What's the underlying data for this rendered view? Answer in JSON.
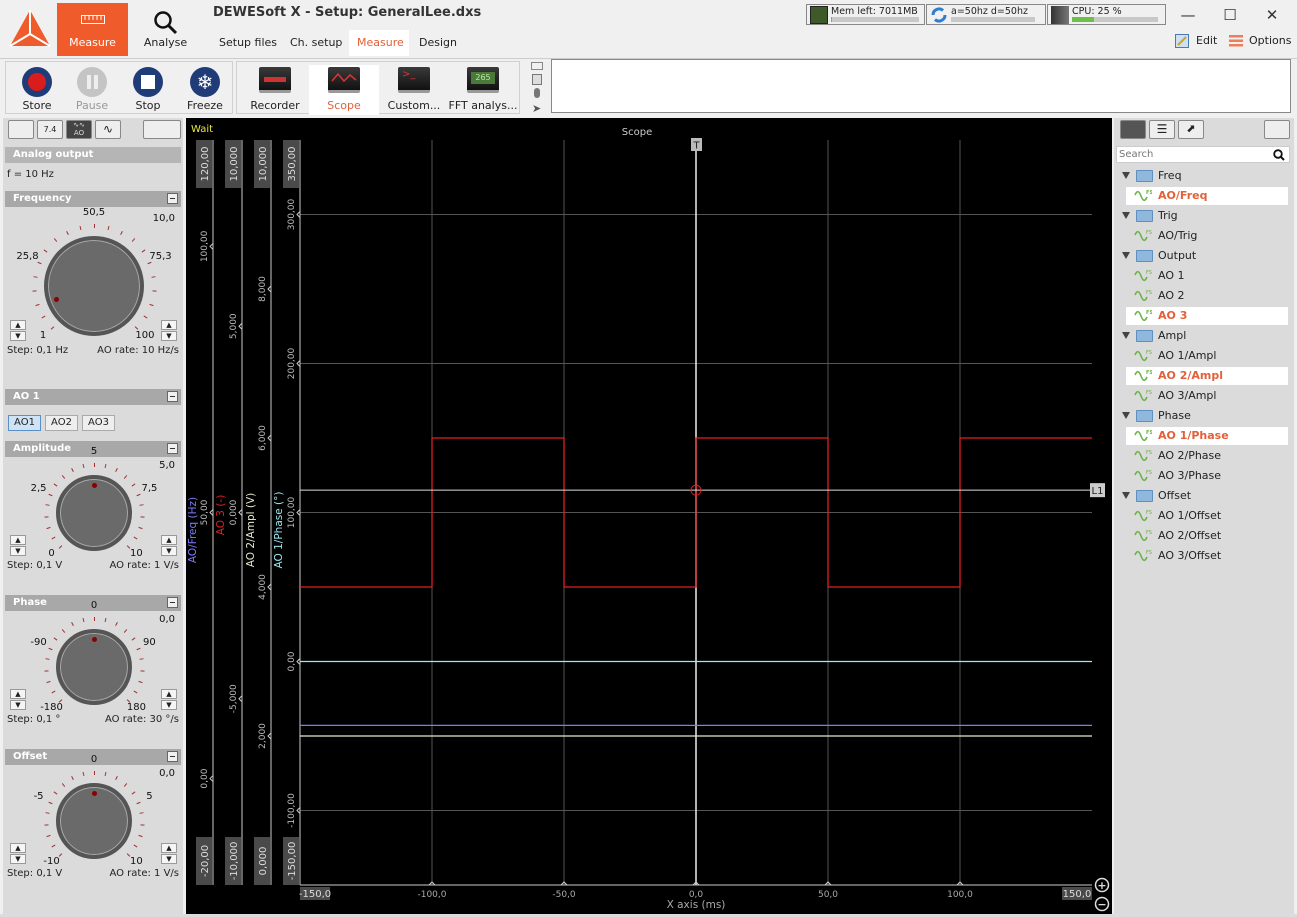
{
  "app": {
    "title": "DEWESoft X - Setup: GeneralLee.dxs",
    "modes": [
      {
        "label": "Measure",
        "icon": "measure-ruler-icon",
        "active": true
      },
      {
        "label": "Analyse",
        "icon": "magnifier-icon",
        "active": false
      }
    ],
    "subtabs": [
      {
        "label": "Setup files",
        "active": false
      },
      {
        "label": "Ch. setup",
        "active": false
      },
      {
        "label": "Measure",
        "active": true
      },
      {
        "label": "Design",
        "active": false
      }
    ],
    "status": {
      "memory": {
        "label": "Mem left: 7011MB",
        "fill": 0.01
      },
      "sync": {
        "label": "a=50hz d=50hz",
        "fill": 0.0
      },
      "cpu": {
        "label": "CPU: 25 %",
        "fill": 0.25,
        "color": "#6cc04a"
      }
    },
    "edit_label": "Edit",
    "options_label": "Options",
    "accent": "#ef5b2b"
  },
  "toolbar": {
    "acquisition": [
      {
        "label": "Store",
        "icon": "record-icon",
        "enabled": true
      },
      {
        "label": "Pause",
        "icon": "pause-icon",
        "enabled": false
      },
      {
        "label": "Stop",
        "icon": "stop-icon",
        "enabled": true
      },
      {
        "label": "Freeze",
        "icon": "snowflake-icon",
        "enabled": true
      }
    ],
    "displays": [
      {
        "label": "Recorder",
        "active": false
      },
      {
        "label": "Scope",
        "active": true
      },
      {
        "label": "Custom...",
        "active": false
      },
      {
        "label": "FFT analys...",
        "active": false
      }
    ],
    "note_text": ""
  },
  "left_panel": {
    "header": "Analog output",
    "freq_readout": "f = 10 Hz",
    "frequency": {
      "title": "Frequency",
      "value": "10,0",
      "labels": [
        "1",
        "25,8",
        "50,5",
        "75,3",
        "100"
      ],
      "step": "Step: 0,1 Hz",
      "rate": "AO rate: 10 Hz/s",
      "position": 0.091
    },
    "ao_section": {
      "title": "AO 1",
      "buttons": [
        "AO1",
        "AO2",
        "AO3"
      ],
      "active_index": 0
    },
    "amplitude": {
      "title": "Amplitude",
      "value": "5,0",
      "labels": [
        "0",
        "2,5",
        "5",
        "7,5",
        "10"
      ],
      "step": "Step: 0,1 V",
      "rate": "AO rate: 1 V/s",
      "position": 0.5
    },
    "phase": {
      "title": "Phase",
      "value": "0,0",
      "labels": [
        "-180",
        "-90",
        "0",
        "90",
        "180"
      ],
      "step": "Step: 0,1 °",
      "rate": "AO rate: 30 °/s",
      "position": 0.5
    },
    "offset": {
      "title": "Offset",
      "value": "0,0",
      "labels": [
        "-10",
        "-5",
        "0",
        "5",
        "10"
      ],
      "step": "Step: 0,1 V",
      "rate": "AO rate: 1 V/s",
      "position": 0.5
    }
  },
  "scope": {
    "title": "Scope",
    "status": "Wait",
    "trigger_marker": "T",
    "level_marker": "L1",
    "zoom_in": "+",
    "zoom_out": "−"
  },
  "chart_data": {
    "type": "line",
    "title": "Scope",
    "xlabel": "X axis (ms)",
    "xlim": [
      -150,
      150
    ],
    "x_ticks": [
      "-150,0",
      "-100,0",
      "-50,0",
      "0,0",
      "50,0",
      "100,0",
      "150,0"
    ],
    "x_tick_values": [
      -150,
      -100,
      -50,
      0,
      50,
      100,
      150
    ],
    "grid": true,
    "axes": [
      {
        "name": "AO/Freq (Hz)",
        "color": "#7b7bff",
        "range": [
          -20,
          120
        ],
        "min_label": "-20,00",
        "max_label": "120,00",
        "ticks": [
          {
            "v": 100,
            "l": "100,00"
          },
          {
            "v": 50,
            "l": "50,00"
          },
          {
            "v": 0,
            "l": "0,00"
          }
        ]
      },
      {
        "name": "AO 3 (-)",
        "color": "#e02020",
        "range": [
          -10,
          10
        ],
        "min_label": "-10,000",
        "max_label": "10,000",
        "ticks": [
          {
            "v": 5,
            "l": "5,000"
          },
          {
            "v": 0,
            "l": "0,000"
          },
          {
            "v": -5,
            "l": "-5,000"
          }
        ]
      },
      {
        "name": "AO 2/Ampl (V)",
        "color": "#e8e8d0",
        "range": [
          0,
          10
        ],
        "min_label": "0,000",
        "max_label": "10,000",
        "ticks": [
          {
            "v": 8,
            "l": "8,000"
          },
          {
            "v": 6,
            "l": "6,000"
          },
          {
            "v": 4,
            "l": "4,000"
          },
          {
            "v": 2,
            "l": "2,000"
          }
        ]
      },
      {
        "name": "AO 1/Phase (°)",
        "color": "#9ee8f5",
        "range": [
          -150,
          350
        ],
        "min_label": "-150,00",
        "max_label": "350,00",
        "ticks": [
          {
            "v": 300,
            "l": "300,00"
          },
          {
            "v": 200,
            "l": "200,00"
          },
          {
            "v": 100,
            "l": "100,00"
          },
          {
            "v": 0,
            "l": "0,00"
          },
          {
            "v": -100,
            "l": "-100,00"
          }
        ]
      }
    ],
    "series": [
      {
        "name": "AO 3",
        "axis": 1,
        "color": "#e02020",
        "type": "step",
        "x": [
          -150,
          -100,
          -100,
          -50,
          -50,
          0,
          0,
          50,
          50,
          100,
          100,
          150
        ],
        "y": [
          -2,
          -2,
          2,
          2,
          -2,
          -2,
          2,
          2,
          -2,
          -2,
          2,
          2
        ]
      },
      {
        "name": "AO/Freq",
        "axis": 0,
        "color": "#7b7bff",
        "x": [
          -150,
          150
        ],
        "y": [
          10,
          10
        ]
      },
      {
        "name": "AO 2/Ampl",
        "axis": 2,
        "color": "#e8e8d0",
        "x": [
          -150,
          150
        ],
        "y": [
          2,
          2
        ]
      },
      {
        "name": "AO 1/Phase",
        "axis": 3,
        "color": "#9ee8f5",
        "x": [
          -150,
          150
        ],
        "y": [
          0,
          0
        ]
      }
    ],
    "trigger_level": 115,
    "trigger_level_axis": 3
  },
  "right_panel": {
    "search_placeholder": "Search",
    "groups": [
      {
        "label": "Freq",
        "items": [
          {
            "label": "AO/Freq",
            "selected": true
          }
        ]
      },
      {
        "label": "Trig",
        "items": [
          {
            "label": "AO/Trig",
            "selected": false
          }
        ]
      },
      {
        "label": "Output",
        "items": [
          {
            "label": "AO 1",
            "selected": false
          },
          {
            "label": "AO 2",
            "selected": false
          },
          {
            "label": "AO 3",
            "selected": true
          }
        ]
      },
      {
        "label": "Ampl",
        "items": [
          {
            "label": "AO 1/Ampl",
            "selected": false
          },
          {
            "label": "AO 2/Ampl",
            "selected": true
          },
          {
            "label": "AO 3/Ampl",
            "selected": false
          }
        ]
      },
      {
        "label": "Phase",
        "items": [
          {
            "label": "AO 1/Phase",
            "selected": true
          },
          {
            "label": "AO 2/Phase",
            "selected": false
          },
          {
            "label": "AO 3/Phase",
            "selected": false
          }
        ]
      },
      {
        "label": "Offset",
        "items": [
          {
            "label": "AO 1/Offset",
            "selected": false
          },
          {
            "label": "AO 2/Offset",
            "selected": false
          },
          {
            "label": "AO 3/Offset",
            "selected": false
          }
        ]
      }
    ]
  }
}
